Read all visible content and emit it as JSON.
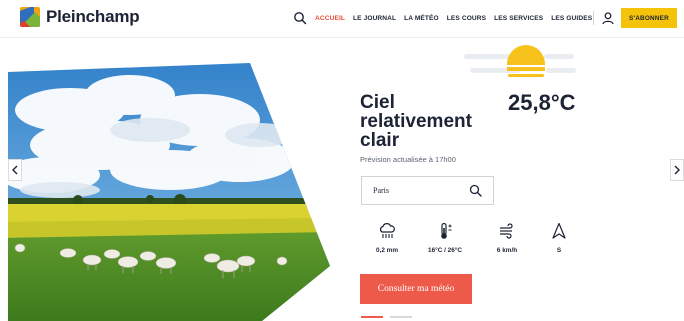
{
  "brand": {
    "name": "Pleinchamp"
  },
  "nav": {
    "items": [
      {
        "label": "ACCUEIL",
        "active": true
      },
      {
        "label": "LE JOURNAL",
        "active": false
      },
      {
        "label": "LA MÉTÉO",
        "active": false
      },
      {
        "label": "LES COURS",
        "active": false
      },
      {
        "label": "LES SERVICES",
        "active": false
      },
      {
        "label": "LES GUIDES",
        "active": false
      }
    ],
    "subscribe_label": "S'ABONNER"
  },
  "weather": {
    "condition_lines": [
      "Ciel",
      "relativement",
      "clair"
    ],
    "temperature": "25,8°C",
    "updated": "Prévision actualisée à 17h00",
    "city": "Paris",
    "metrics": [
      {
        "icon": "rain-cloud-icon",
        "value": "0,2 mm"
      },
      {
        "icon": "thermometer-icon",
        "value": "16°C / 26°C"
      },
      {
        "icon": "wind-icon",
        "value": "6 km/h"
      },
      {
        "icon": "wind-direction-icon",
        "value": "S"
      }
    ],
    "cta_label": "Consulter ma météo"
  },
  "colors": {
    "accent": "#ee5a49",
    "nav_active": "#e8503a",
    "subscribe": "#f5c30a",
    "sun": "#f7c21b",
    "text": "#1c2335"
  }
}
